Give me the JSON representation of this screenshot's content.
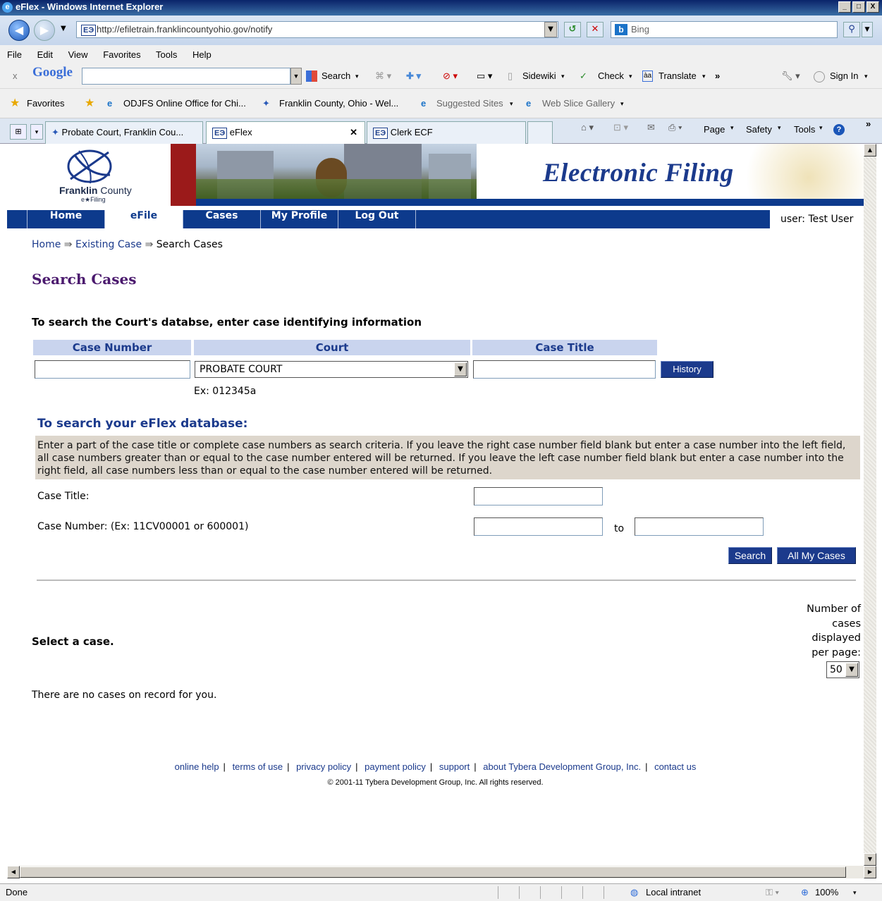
{
  "browser": {
    "title": "eFlex - Windows Internet Explorer",
    "address": "http://efiletrain.franklincountyohio.gov/notify",
    "search_placeholder": "Bing",
    "menu": [
      "File",
      "Edit",
      "View",
      "Favorites",
      "Tools",
      "Help"
    ],
    "google_bar": {
      "search_label": "Search",
      "sidewiki": "Sidewiki",
      "check": "Check",
      "translate": "Translate",
      "sign_in": "Sign In"
    },
    "favorites": {
      "label": "Favorites",
      "items": [
        "ODJFS Online Office for Chi...",
        "Franklin County, Ohio - Wel...",
        "Suggested Sites",
        "Web Slice Gallery"
      ]
    },
    "tabs": [
      "Probate Court, Franklin Cou...",
      "eFlex",
      "Clerk ECF"
    ],
    "command_bar": [
      "Page",
      "Safety",
      "Tools"
    ],
    "status": {
      "left": "Done",
      "zone": "Local intranet",
      "zoom": "100%"
    }
  },
  "site": {
    "logo_name": "Franklin",
    "logo_county": "County",
    "logo_sub": "e★Filing",
    "banner_title": "Electronic Filing",
    "nav": [
      "Home",
      "eFile",
      "Cases",
      "My Profile",
      "Log Out"
    ],
    "user": "user: Test User"
  },
  "breadcrumb": {
    "home": "Home",
    "existing": "Existing Case",
    "current": "Search Cases",
    "sep": "⇛"
  },
  "page_title": "Search Cases",
  "court_search": {
    "heading": "To search the Court's databse, enter case identifying information",
    "col_case_number": "Case Number",
    "col_court": "Court",
    "col_case_title": "Case Title",
    "court_selected": "PROBATE COURT",
    "history_button": "History",
    "example": "Ex:  012345a"
  },
  "eflex_search": {
    "heading": "To search your eFlex database:",
    "instructions": "Enter a part of the case title or complete case numbers as search criteria. If you leave the right case number field blank but enter a case number into the left field, all case numbers greater than or equal to the case number entered will be returned. If you leave the left case number field blank but enter a case number into the right field, all case numbers less than or equal to the case number entered will be returned.",
    "case_title_label": "Case Title:",
    "case_number_label": "Case Number: (Ex:  11CV00001 or 600001)",
    "to_label": "to",
    "search_button": "Search",
    "all_cases_button": "All My Cases"
  },
  "results": {
    "select_label": "Select a case.",
    "per_page_label": "Number of cases displayed per page:",
    "per_page_value": "50",
    "empty_message": "There are no cases on record for you."
  },
  "footer": {
    "links": [
      "online help",
      "terms of use",
      "privacy policy",
      "payment policy",
      "support",
      "about Tybera Development Group, Inc.",
      "contact us"
    ],
    "copyright": "© 2001-11 Tybera Development Group, Inc. All rights reserved."
  }
}
